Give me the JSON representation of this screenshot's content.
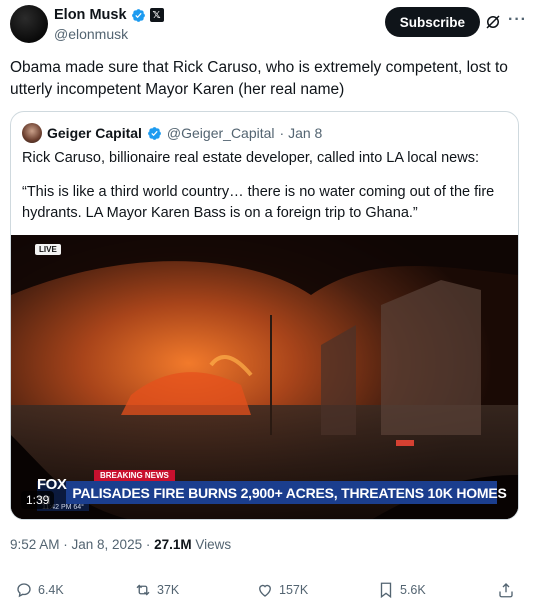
{
  "author": {
    "name": "Elon Musk",
    "handle": "@elonmusk"
  },
  "header": {
    "subscribe_label": "Subscribe"
  },
  "tweet": {
    "text": "Obama made sure that Rick Caruso, who is extremely competent, lost to utterly incompetent Mayor Karen (her real name)"
  },
  "quote": {
    "name": "Geiger Capital",
    "handle": "@Geiger_Capital",
    "date": "· Jan 8",
    "line1": "Rick Caruso, billionaire real estate developer, called into LA local news:",
    "line2": "“This is like a third world country… there is no water coming out of the fire hydrants. LA Mayor Karen Bass is on a foreign trip to Ghana.”",
    "video": {
      "live": "LIVE",
      "breaking": "BREAKING NEWS",
      "channel": "FOX 11",
      "headline": "PALISADES FIRE BURNS 2,900+ ACRES, THREATENS 10K HOMES",
      "meta": "11:42 PM  64°",
      "duration": "1:39"
    }
  },
  "meta": {
    "time": "9:52 AM · Jan 8, 2025 · ",
    "views_count": "27.1M",
    "views_label": " Views"
  },
  "actions": {
    "replies": "6.4K",
    "reposts": "37K",
    "likes": "157K",
    "bookmarks": "5.6K"
  },
  "colors": {
    "verified": "#1d9bf0",
    "text": "#0f1419",
    "muted": "#536471",
    "border": "#cfd9de"
  }
}
